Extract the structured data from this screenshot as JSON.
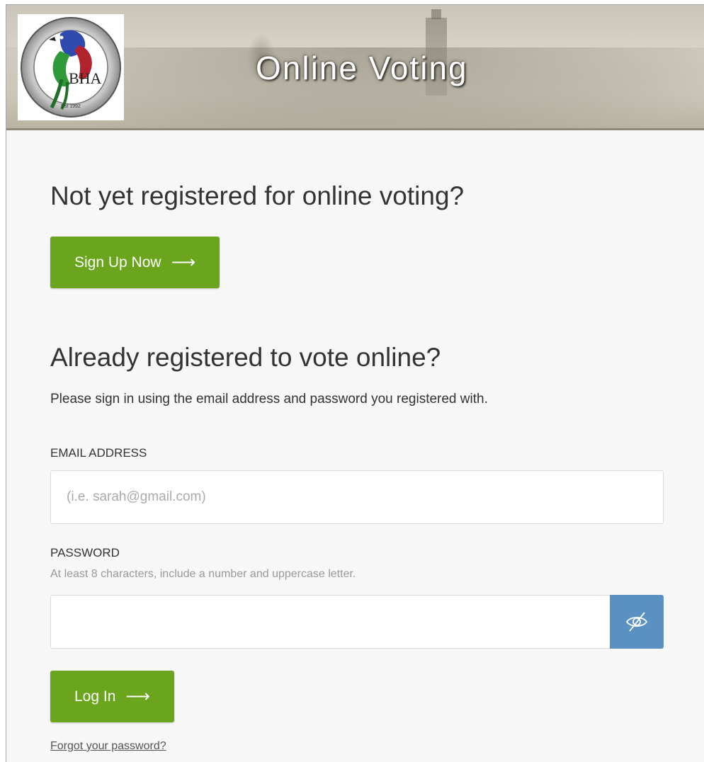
{
  "header": {
    "title": "Online Voting",
    "logo": {
      "monogram": "BHA",
      "ring_text_top": "BALD HEAD ASSOCIATION",
      "ring_text_bottom": "Est 1992",
      "icon": "bird-logo-icon"
    }
  },
  "signup": {
    "heading": "Not yet registered for online voting?",
    "button_label": "Sign Up Now",
    "button_icon": "arrow-right-icon"
  },
  "login": {
    "heading": "Already registered to vote online?",
    "description": "Please sign in using the email address and password you registered with.",
    "email_label": "EMAIL ADDRESS",
    "email_placeholder": "(i.e. sarah@gmail.com)",
    "password_label": "PASSWORD",
    "password_hint": "At least 8 characters, include a number and uppercase letter.",
    "password_toggle_icon": "eye-slash-icon",
    "button_label": "Log In",
    "button_icon": "arrow-right-icon",
    "forgot_link": "Forgot your password?"
  },
  "colors": {
    "primary_button": "#6ba51e",
    "toggle_button": "#5b91c2",
    "page_background": "#f7f7f7"
  }
}
